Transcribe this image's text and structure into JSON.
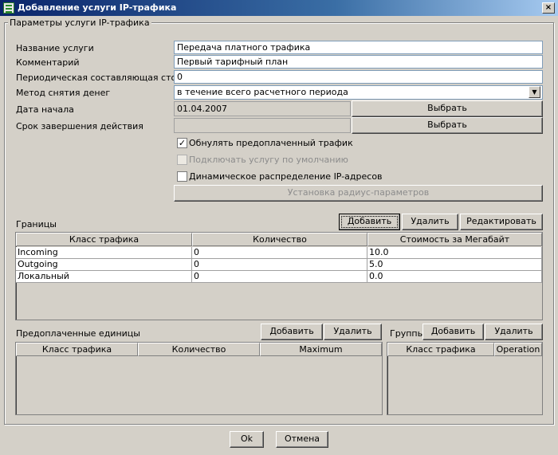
{
  "window": {
    "title": "Добавление услуги IP-трафика"
  },
  "params_group": {
    "title": "Параметры услуги IP-трафика",
    "service_name": {
      "label": "Название услуги",
      "value": "Передача платного трафика"
    },
    "comment": {
      "label": "Комментарий",
      "value": "Первый тарифный план"
    },
    "periodic_cost": {
      "label": "Периодическая составляющая стоимости",
      "value": "0"
    },
    "withdraw_method": {
      "label": "Метод снятия денег",
      "value": "в течение всего расчетного периода"
    },
    "start_date": {
      "label": "Дата начала",
      "value": "01.04.2007",
      "button": "Выбрать"
    },
    "end_date": {
      "label": "Срок завершения действия",
      "value": "",
      "button": "Выбрать"
    },
    "checkboxes": [
      {
        "label": "Обнулять предоплаченный трафик",
        "checked": true,
        "enabled": true
      },
      {
        "label": "Подключать услугу по умолчанию",
        "checked": false,
        "enabled": false
      },
      {
        "label": "Динамическое распределение IP-адресов",
        "checked": false,
        "enabled": true
      }
    ],
    "radius_button": "Установка радиус-параметров"
  },
  "borders": {
    "title": "Границы",
    "add": "Добавить",
    "remove": "Удалить",
    "edit": "Редактировать",
    "columns": [
      "Класс трафика",
      "Количество",
      "Стоимость за Мегабайт"
    ],
    "rows": [
      [
        "Incoming",
        "0",
        "10.0"
      ],
      [
        "Outgoing",
        "0",
        "5.0"
      ],
      [
        "Локальный",
        "0",
        "0.0"
      ]
    ]
  },
  "prepaid": {
    "title": "Предоплаченные единицы",
    "add": "Добавить",
    "remove": "Удалить",
    "columns": [
      "Класс трафика",
      "Количество",
      "Maximum"
    ]
  },
  "groups": {
    "title": "Группы",
    "add": "Добавить",
    "remove": "Удалить",
    "columns": [
      "Класс трафика",
      "Operation"
    ]
  },
  "footer": {
    "ok": "Ok",
    "cancel": "Отмена"
  },
  "colors": {
    "titlebar_start": "#0a246a",
    "titlebar_end": "#a6caf0",
    "face": "#d4d0c8"
  }
}
